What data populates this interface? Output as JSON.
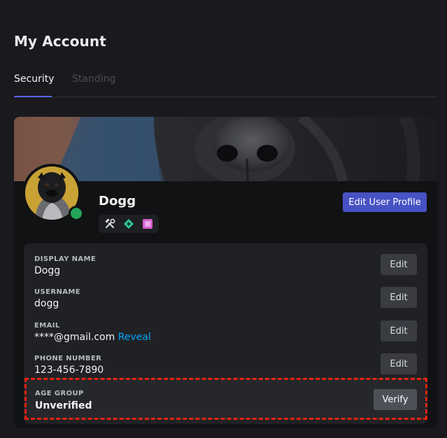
{
  "page": {
    "title": "My Account"
  },
  "tabs": [
    {
      "label": "Security",
      "active": true
    },
    {
      "label": "Standing",
      "active": false
    }
  ],
  "profile": {
    "display_name": "Dogg",
    "edit_profile_label": "Edit User Profile",
    "status": "online",
    "badges": [
      "hammer-wrench-icon",
      "diamond-badge-icon",
      "pink-square-badge-icon"
    ]
  },
  "fields": {
    "display_name": {
      "label": "DISPLAY NAME",
      "value": "Dogg",
      "button": "Edit"
    },
    "username": {
      "label": "USERNAME",
      "value": "dogg",
      "button": "Edit"
    },
    "email": {
      "label": "EMAIL",
      "value": "****@gmail.com",
      "reveal": "Reveal",
      "button": "Edit"
    },
    "phone": {
      "label": "PHONE NUMBER",
      "value": "123-456-7890",
      "button": "Edit"
    },
    "age_group": {
      "label": "AGE GROUP",
      "value": "Unverified",
      "button": "Verify"
    }
  },
  "colors": {
    "accent": "#4752c4",
    "online": "#23a55a",
    "link": "#00a8fc",
    "highlight": "#e8230f"
  }
}
